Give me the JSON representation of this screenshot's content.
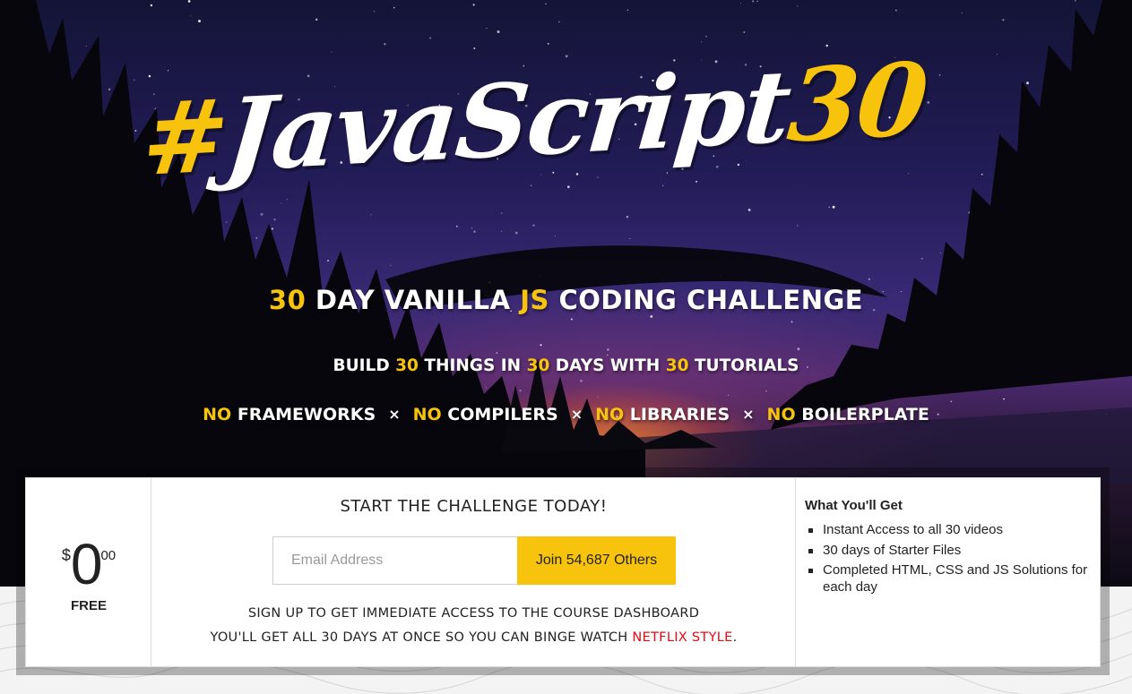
{
  "hero": {
    "logo": {
      "hash": "#",
      "word": "JavaScript",
      "number": "30"
    },
    "headline": {
      "num": "30",
      "part1": "DAY VANILLA",
      "js": "JS",
      "part2": "CODING CHALLENGE"
    },
    "subline": {
      "build": "BUILD",
      "num1": "30",
      "things": "THINGS IN",
      "num2": "30",
      "days": "DAYS WITH",
      "num3": "30",
      "tutorials": "TUTORIALS"
    },
    "no_list": {
      "no_word": "NO",
      "separator": "×",
      "items": [
        "FRAMEWORKS",
        "COMPILERS",
        "LIBRARIES",
        "BOILERPLATE"
      ]
    }
  },
  "pricing": {
    "currency": "$",
    "amount": "0",
    "cents": "00",
    "label": "FREE"
  },
  "signup": {
    "title": "START THE CHALLENGE TODAY!",
    "email_placeholder": "Email Address",
    "join_label": "Join 54,687 Others",
    "line1": "SIGN UP TO GET IMMEDIATE ACCESS TO THE COURSE DASHBOARD",
    "line2_prefix": "YOU'LL GET ALL 30 DAYS AT ONCE SO YOU CAN BINGE WATCH",
    "line2_highlight": "NETFLIX STYLE",
    "line2_suffix": "."
  },
  "benefits": {
    "title": "What You'll Get",
    "items": [
      "Instant Access to all 30 videos",
      "30 days of Starter Files",
      "Completed HTML, CSS and JS Solutions for each day"
    ]
  },
  "colors": {
    "accent": "#f7c30d",
    "highlight_red": "#e50914",
    "text_dark": "#222222",
    "sky_dark": "#141437",
    "sky_purple": "#3a2a76",
    "fire": "#ff8c28"
  }
}
